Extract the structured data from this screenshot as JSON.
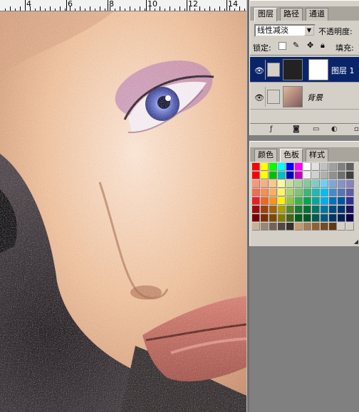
{
  "ruler": {
    "labels": [
      "4",
      "6",
      "8",
      "10",
      "12",
      "14"
    ]
  },
  "layers_panel": {
    "tabs": [
      "图层",
      "路径",
      "通道"
    ],
    "blend_mode": "线性减淡",
    "opacity_label": "不透明度:",
    "lock_label": "锁定:",
    "fill_label": "填充:",
    "layers": [
      {
        "name": "图层 1",
        "selected": true,
        "visible": true
      },
      {
        "name": "背景",
        "selected": false,
        "visible": true
      }
    ],
    "toolbar_icons": [
      "link-icon",
      "layer-style-icon",
      "mask-icon",
      "adjustment-icon",
      "new-set-icon",
      "new-layer-icon"
    ]
  },
  "swatches_panel": {
    "tabs": [
      "颜色",
      "色板",
      "样式"
    ],
    "rows": [
      [
        "#ff0000",
        "#ffff00",
        "#00ff00",
        "#00ffff",
        "#0000ff",
        "#ff00ff",
        "#ffffff",
        "#e0e0e0",
        "#c0c0c0",
        "#a0a0a0",
        "#808080",
        "#606060"
      ],
      [
        "#ff0000",
        "#ffff00",
        "#00c000",
        "#00c0c0",
        "#0000c0",
        "#c000c0",
        "#f0f0f0",
        "#d0d0d0",
        "#b0b0b0",
        "#909090",
        "#707070",
        "#404040"
      ],
      [
        "#f7977a",
        "#f9ad81",
        "#fdc68a",
        "#fff79a",
        "#c4df9b",
        "#a3d39c",
        "#82ca9d",
        "#7bcdc8",
        "#6ecff6",
        "#7ea7d8",
        "#8493ca",
        "#8882be"
      ],
      [
        "#f26c4f",
        "#f68e55",
        "#fbaf5c",
        "#fff467",
        "#acd372",
        "#7cc576",
        "#3bb878",
        "#1abbb4",
        "#00bff3",
        "#438ccb",
        "#5574b9",
        "#605ca8"
      ],
      [
        "#ed1c24",
        "#f26522",
        "#f7941d",
        "#fff200",
        "#8dc73f",
        "#39b54a",
        "#00a651",
        "#00a99d",
        "#00aeef",
        "#0072bc",
        "#0054a6",
        "#2e3192"
      ],
      [
        "#9e0b0f",
        "#a0410d",
        "#a36209",
        "#aba000",
        "#598527",
        "#1a7b30",
        "#007236",
        "#00746b",
        "#0076a3",
        "#004b80",
        "#003471",
        "#1b1464"
      ],
      [
        "#790000",
        "#7b2e00",
        "#7d4900",
        "#827b00",
        "#406618",
        "#005e20",
        "#005826",
        "#005952",
        "#005b7f",
        "#003663",
        "#002157",
        "#0d004c"
      ],
      [
        "#c7b299",
        "#998675",
        "#736357",
        "#534741",
        "#37302d",
        "#c69c6d",
        "#a67c52",
        "#8c6239",
        "#754c24",
        "#603913",
        "#d4d0c8",
        "#d4d0c8"
      ]
    ]
  }
}
